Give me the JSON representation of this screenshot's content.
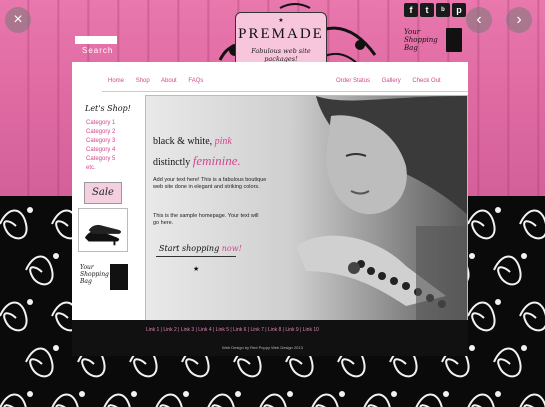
{
  "overlay": {
    "close_icon": "×",
    "prev_icon": "‹",
    "next_icon": "›"
  },
  "header": {
    "search_label": "Search",
    "logo_title": "PREMADE",
    "logo_star": "★",
    "logo_tagline": "Fabulous web site packages!",
    "social_icons": [
      "f",
      "t",
      "ᵇ",
      "p"
    ],
    "bag_text_1": "Your",
    "bag_text_2": "Shopping",
    "bag_text_3": "Bag"
  },
  "nav": {
    "left": [
      "Home",
      "Shop",
      "About",
      "FAQs"
    ],
    "right": [
      "Order Status",
      "Gallery",
      "Check Out"
    ]
  },
  "sidebar": {
    "heading": "Let's Shop!",
    "categories": [
      "Category 1",
      "Category 2",
      "Category 3",
      "Category 4",
      "Category 5",
      "etc."
    ],
    "sale_label": "Sale",
    "bag_text_1": "Your",
    "bag_text_2": "Shopping",
    "bag_text_3": "Bag"
  },
  "hero": {
    "h1_plain": "black & white,",
    "h1_pink": "pink",
    "h2_plain": "distinctly",
    "h2_pink": "feminine.",
    "body1": "Add your text here! This is a fabulous boutique web site done in elegant and striking colors.",
    "body2": "This is the sample homepage. Your text will go here.",
    "cta_plain": "Start shopping",
    "cta_pink": "now!",
    "star": "★"
  },
  "footer": {
    "links": "Link 1 | Link 2 | Link 3 | Link 4 | Link 5 | Link 6 | Link 7 | Link 8 | Link 9 | Link 10",
    "credit": "Web Design by Red Poppy Web Design 2013"
  },
  "colors": {
    "pink_accent": "#d2488e",
    "wood_pink": "#e06ba3",
    "black": "#111111"
  }
}
